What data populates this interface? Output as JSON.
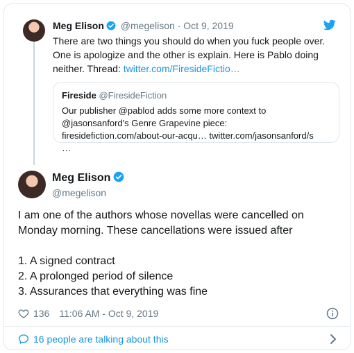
{
  "parent_tweet": {
    "name": "Meg Elison",
    "handle": "@megelison",
    "separator": "·",
    "date": "Oct 9, 2019",
    "text_lines": [
      "There are two things you should do when you fuck people over.",
      "One is apologize and the other is explain. Here is Pablo doing",
      "neither. Thread: "
    ],
    "link": "twitter.com/FiresideFictio…"
  },
  "quoted_tweet": {
    "name": "Fireside",
    "handle": "@FiresideFiction",
    "text_lines": [
      "Our publisher @pablod adds some more context to",
      "@jasonsanford's Genre Grapevine piece:",
      "firesidefiction.com/about-our-acqu… twitter.com/jasonsanford/s",
      "…"
    ]
  },
  "main_tweet": {
    "name": "Meg Elison",
    "handle": "@megelison",
    "paragraph_lines": [
      "I am one of the authors whose novellas were cancelled on",
      "Monday morning. These cancellations were issued after"
    ],
    "list_items": [
      "1. A signed contract",
      "2. A prolonged period of silence",
      "3. Assurances that everything was fine"
    ],
    "likes": "136",
    "timestamp": "11:06 AM - Oct 9, 2019"
  },
  "footer": {
    "talking_label": "16 people are talking about this"
  },
  "icons": {
    "verified": "verified-badge-icon",
    "logo": "twitter-bird-icon",
    "like": "heart-icon",
    "info": "info-icon",
    "talk": "speech-bubble-icon",
    "chevron": "chevron-right-icon"
  },
  "colors": {
    "link": "#1b95e0",
    "verified": "#1da1f2",
    "muted": "#657786",
    "border": "#e1e8ed"
  }
}
